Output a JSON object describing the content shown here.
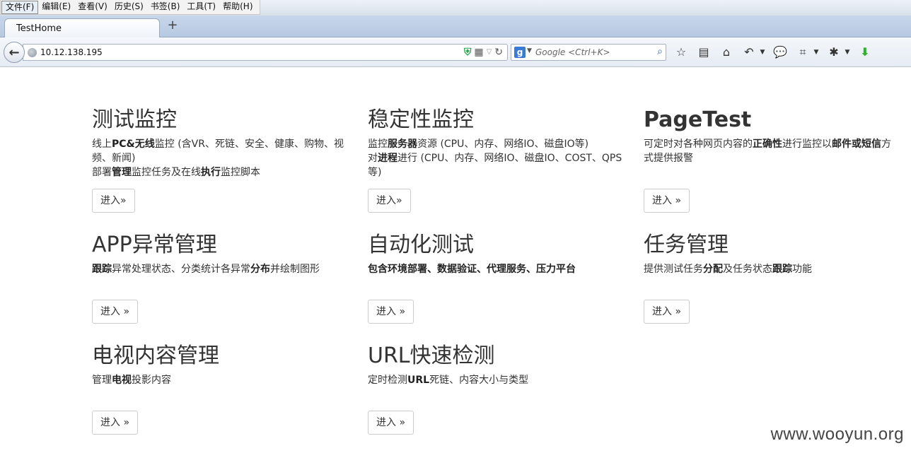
{
  "menu": {
    "items": [
      "文件(F)",
      "编辑(E)",
      "查看(V)",
      "历史(S)",
      "书签(B)",
      "工具(T)",
      "帮助(H)"
    ]
  },
  "tabs": {
    "active_label": "TestHome",
    "new_tab": "+"
  },
  "navbar": {
    "url": "10.12.138.195",
    "search_placeholder": "Google <Ctrl+K>",
    "search_engine_icon": "g"
  },
  "cards": [
    {
      "title": "测试监控",
      "desc_lines": [
        [
          {
            "t": "线上"
          },
          {
            "t": "PC&无线",
            "b": true
          },
          {
            "t": "监控 (含VR、死链、安全、健康、购物、视频、新闻)"
          }
        ],
        [
          {
            "t": "部署"
          },
          {
            "t": "管理",
            "b": true
          },
          {
            "t": "监控任务及在线"
          },
          {
            "t": "执行",
            "b": true
          },
          {
            "t": "监控脚本"
          }
        ]
      ],
      "button": "进入»"
    },
    {
      "title": "稳定性监控",
      "desc_lines": [
        [
          {
            "t": "监控"
          },
          {
            "t": "服务器",
            "b": true
          },
          {
            "t": "资源 (CPU、内存、网络IO、磁盘IO等)"
          }
        ],
        [
          {
            "t": "对"
          },
          {
            "t": "进程",
            "b": true
          },
          {
            "t": "进行 (CPU、内存、网络IO、磁盘IO、COST、QPS等)"
          }
        ]
      ],
      "button": "进入»"
    },
    {
      "title": "PageTest",
      "desc_lines": [
        [
          {
            "t": "可定时对各种网页内容的"
          },
          {
            "t": "正确性",
            "b": true
          },
          {
            "t": "进行监控以"
          },
          {
            "t": "邮件或短信",
            "b": true
          },
          {
            "t": "方式提供报警"
          }
        ]
      ],
      "button": "进入 »"
    },
    {
      "title": "APP异常管理",
      "desc_lines": [
        [
          {
            "t": "跟踪",
            "b": true
          },
          {
            "t": "异常处理状态、分类统计各异常"
          },
          {
            "t": "分布",
            "b": true
          },
          {
            "t": "并绘制图形"
          }
        ]
      ],
      "button": "进入 »"
    },
    {
      "title": "自动化测试",
      "desc_lines": [
        [
          {
            "t": "包含环境部署、数据验证、代理服务、压力平台",
            "b": true
          }
        ]
      ],
      "button": "进入 »"
    },
    {
      "title": "任务管理",
      "desc_lines": [
        [
          {
            "t": "提供测试任务"
          },
          {
            "t": "分配",
            "b": true
          },
          {
            "t": "及任务状态"
          },
          {
            "t": "跟踪",
            "b": true
          },
          {
            "t": "功能"
          }
        ]
      ],
      "button": "进入 »"
    },
    {
      "title": "电视内容管理",
      "desc_lines": [
        [
          {
            "t": "管理"
          },
          {
            "t": "电视",
            "b": true
          },
          {
            "t": "投影内容"
          }
        ]
      ],
      "button": "进入 »"
    },
    {
      "title": "URL快速检测",
      "desc_lines": [
        [
          {
            "t": "定时检测"
          },
          {
            "t": "URL",
            "b": true
          },
          {
            "t": "死链、内容大小与类型"
          }
        ]
      ],
      "button": "进入 »"
    }
  ],
  "watermark": "www.wooyun.org"
}
